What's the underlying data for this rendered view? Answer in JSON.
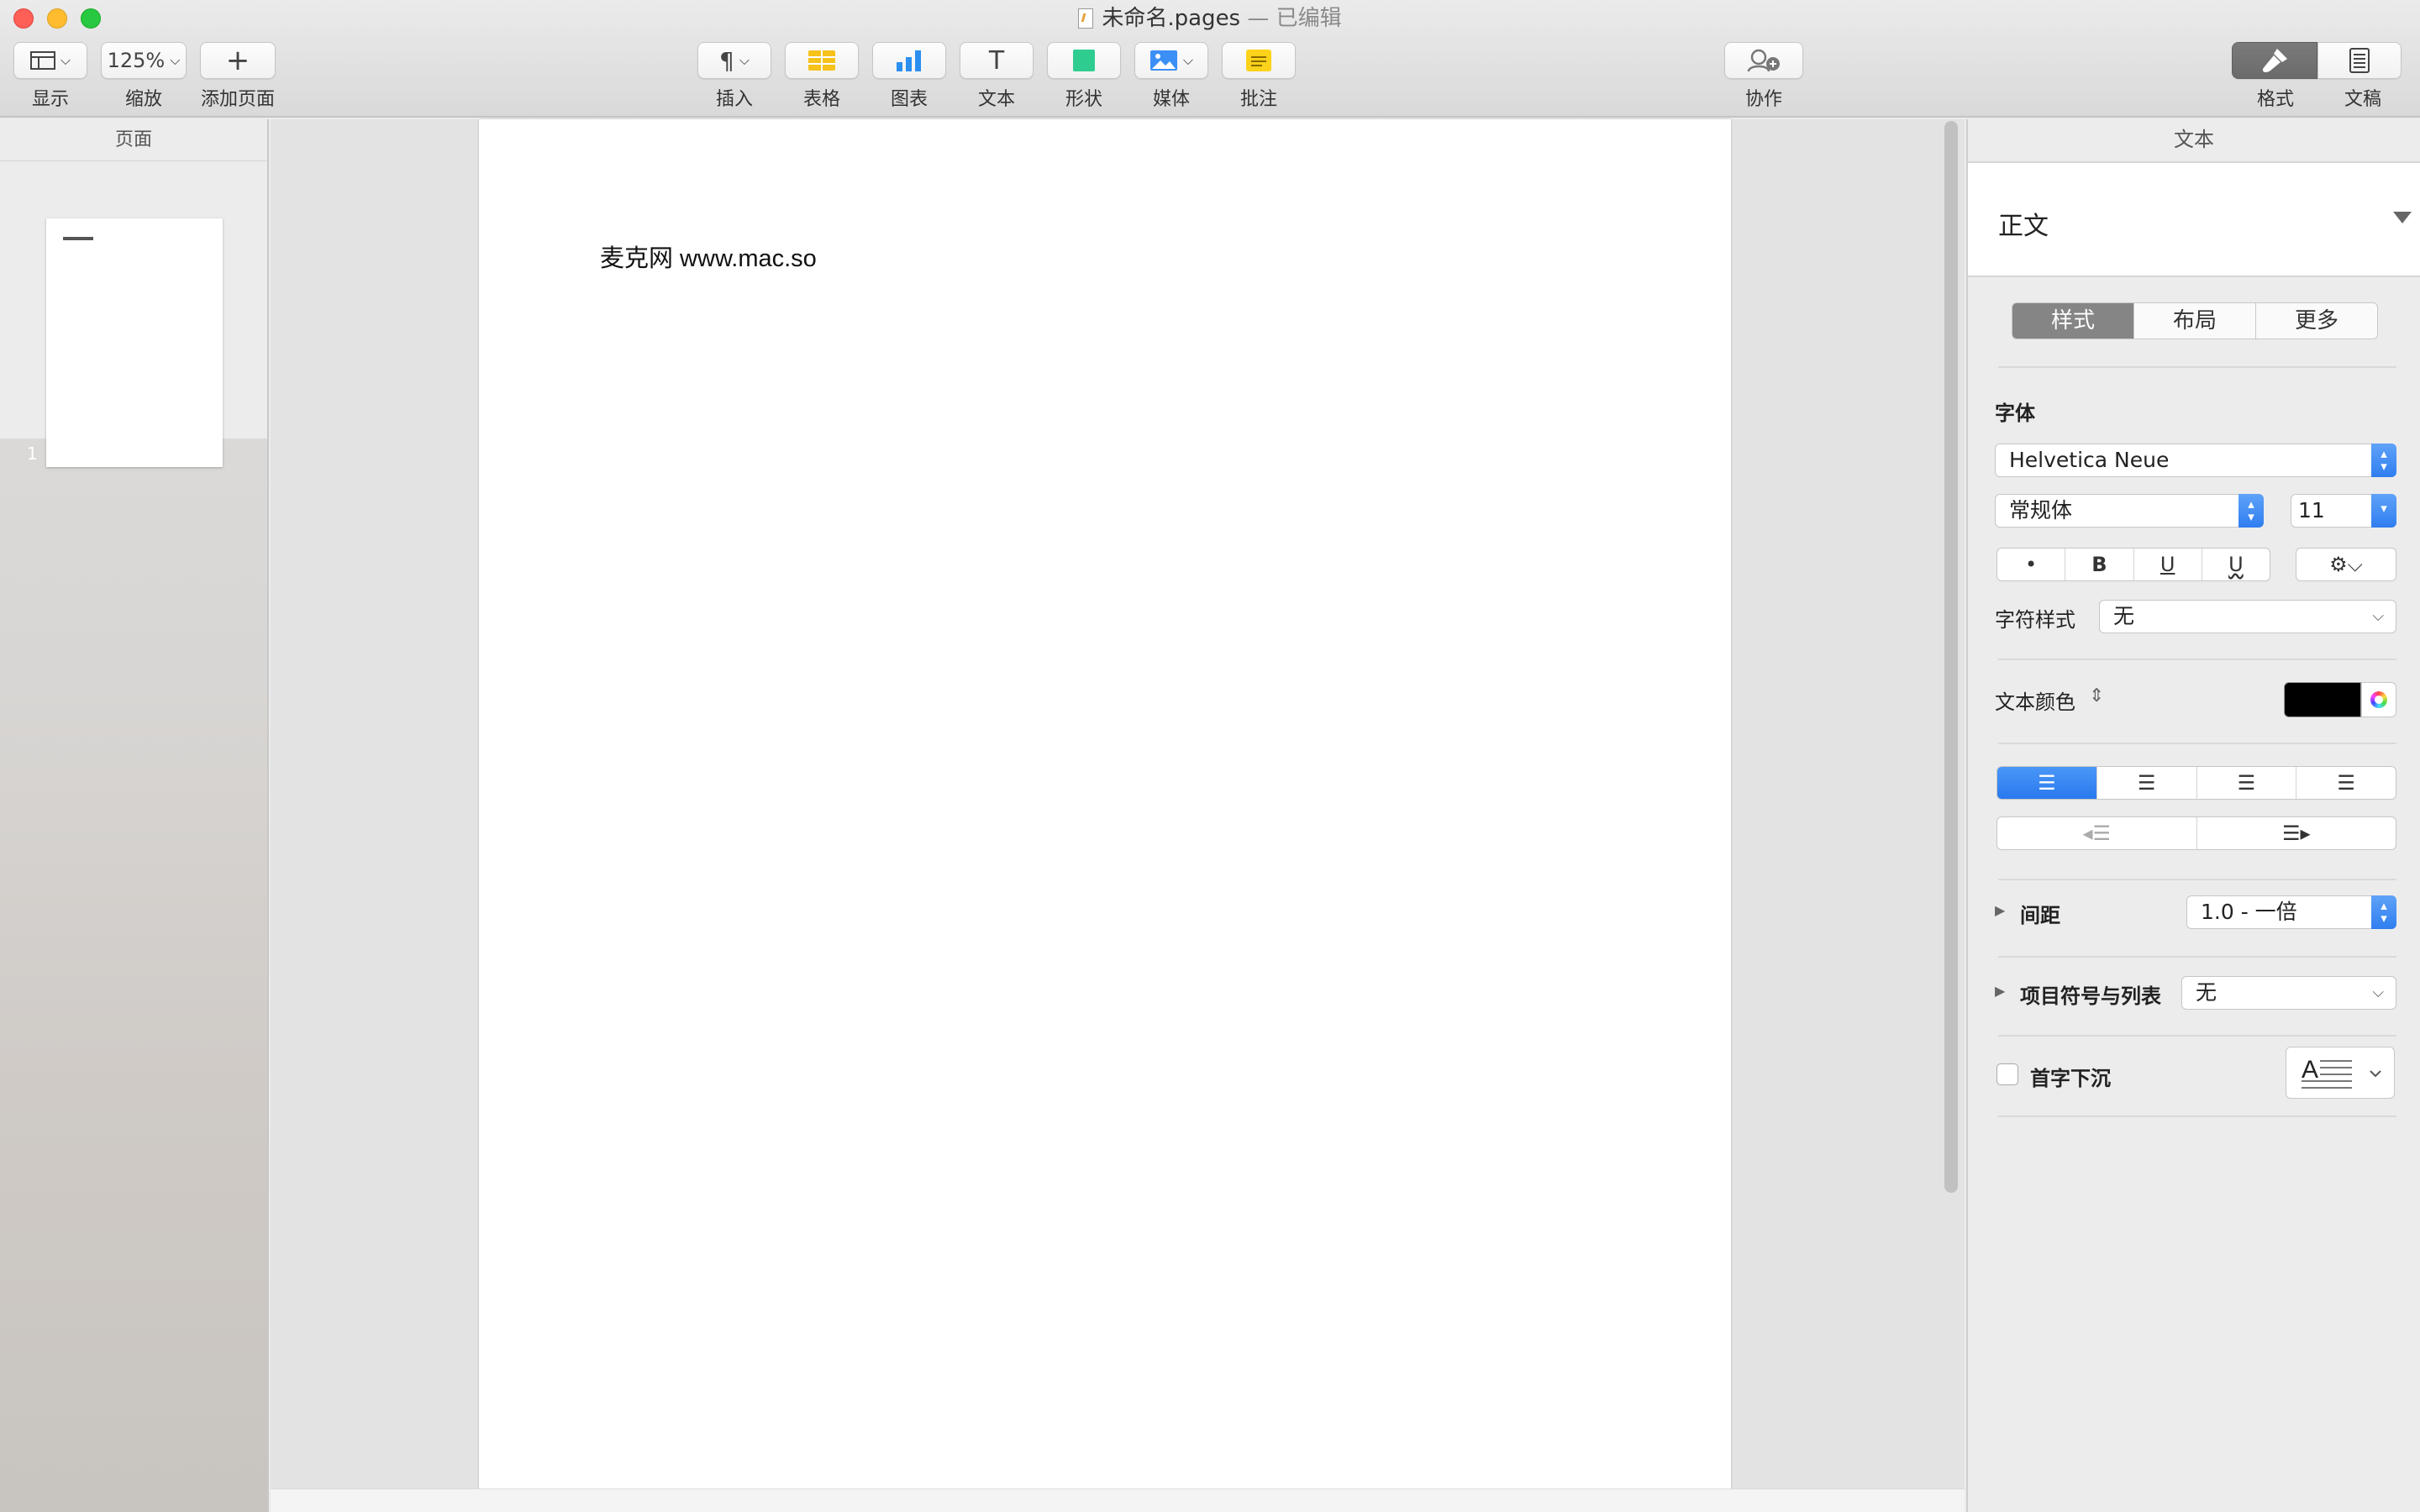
{
  "window": {
    "title": "未命名.pages",
    "edited": "— 已编辑"
  },
  "toolbar": {
    "view_label": "显示",
    "zoom_value": "125%",
    "zoom_label": "缩放",
    "add_page_label": "添加页面",
    "insert_label": "插入",
    "table_label": "表格",
    "chart_label": "图表",
    "text_label": "文本",
    "shape_label": "形状",
    "media_label": "媒体",
    "comment_label": "批注",
    "collaborate_label": "协作",
    "format_label": "格式",
    "document_label": "文稿"
  },
  "sidebar": {
    "header": "页面",
    "page_number": "1"
  },
  "document": {
    "body_text": "麦克网 www.mac.so"
  },
  "inspector": {
    "tab_title": "文本",
    "paragraph_style": "正文",
    "segments": [
      "样式",
      "布局",
      "更多"
    ],
    "font_heading": "字体",
    "font_family": "Helvetica Neue",
    "font_typeface": "常规体",
    "font_size": "11",
    "char_style_label": "字符样式",
    "char_style_value": "无",
    "text_color_label": "文本颜色",
    "text_color": "#000000",
    "spacing_label": "间距",
    "spacing_value": "1.0 - 一倍",
    "bullets_label": "项目符号与列表",
    "bullets_value": "无",
    "dropcap_label": "首字下沉"
  },
  "colors": {
    "accent": "#2f7ef0",
    "selected_segment": "#858585"
  }
}
